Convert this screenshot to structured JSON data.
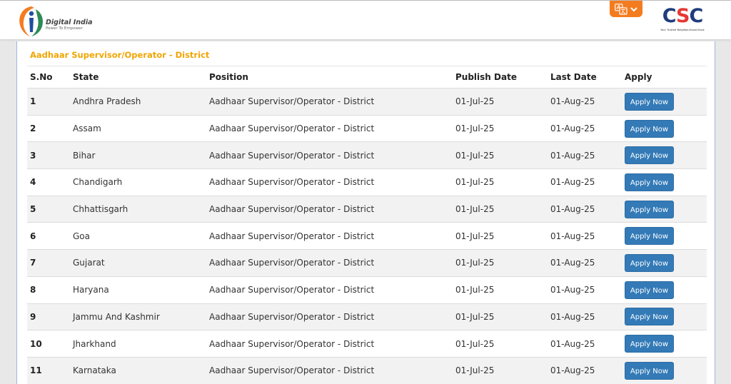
{
  "header": {
    "digital_india": {
      "title": "Digital India",
      "subtitle": "Power To Empower"
    },
    "language_button": {
      "icon": "translate-icon",
      "chevron": "chevron-down-icon",
      "color": "#f47c20"
    },
    "csc": {
      "letters_c1": "C",
      "letters_s": "S",
      "letters_c2": "C",
      "tagline": "Your Trusted Neighbourhood Kiosk"
    }
  },
  "page": {
    "title": "Aadhaar Supervisor/Operator - District",
    "accent_color": "#f0a500",
    "button_color": "#337ab7"
  },
  "table": {
    "headers": {
      "sno": "S.No",
      "state": "State",
      "position": "Position",
      "publish": "Publish Date",
      "last": "Last Date",
      "apply": "Apply"
    },
    "rows": [
      {
        "sno": "1",
        "state": "Andhra Pradesh",
        "position": "Aadhaar Supervisor/Operator - District",
        "publish": "01-Jul-25",
        "last": "01-Aug-25",
        "apply": "Apply Now"
      },
      {
        "sno": "2",
        "state": "Assam",
        "position": "Aadhaar Supervisor/Operator - District",
        "publish": "01-Jul-25",
        "last": "01-Aug-25",
        "apply": "Apply Now"
      },
      {
        "sno": "3",
        "state": "Bihar",
        "position": "Aadhaar Supervisor/Operator - District",
        "publish": "01-Jul-25",
        "last": "01-Aug-25",
        "apply": "Apply Now"
      },
      {
        "sno": "4",
        "state": "Chandigarh",
        "position": "Aadhaar Supervisor/Operator - District",
        "publish": "01-Jul-25",
        "last": "01-Aug-25",
        "apply": "Apply Now"
      },
      {
        "sno": "5",
        "state": "Chhattisgarh",
        "position": "Aadhaar Supervisor/Operator - District",
        "publish": "01-Jul-25",
        "last": "01-Aug-25",
        "apply": "Apply Now"
      },
      {
        "sno": "6",
        "state": "Goa",
        "position": "Aadhaar Supervisor/Operator - District",
        "publish": "01-Jul-25",
        "last": "01-Aug-25",
        "apply": "Apply Now"
      },
      {
        "sno": "7",
        "state": "Gujarat",
        "position": "Aadhaar Supervisor/Operator - District",
        "publish": "01-Jul-25",
        "last": "01-Aug-25",
        "apply": "Apply Now"
      },
      {
        "sno": "8",
        "state": "Haryana",
        "position": "Aadhaar Supervisor/Operator - District",
        "publish": "01-Jul-25",
        "last": "01-Aug-25",
        "apply": "Apply Now"
      },
      {
        "sno": "9",
        "state": "Jammu And Kashmir",
        "position": "Aadhaar Supervisor/Operator - District",
        "publish": "01-Jul-25",
        "last": "01-Aug-25",
        "apply": "Apply Now"
      },
      {
        "sno": "10",
        "state": "Jharkhand",
        "position": "Aadhaar Supervisor/Operator - District",
        "publish": "01-Jul-25",
        "last": "01-Aug-25",
        "apply": "Apply Now"
      },
      {
        "sno": "11",
        "state": "Karnataka",
        "position": "Aadhaar Supervisor/Operator - District",
        "publish": "01-Jul-25",
        "last": "01-Aug-25",
        "apply": "Apply Now"
      }
    ]
  }
}
